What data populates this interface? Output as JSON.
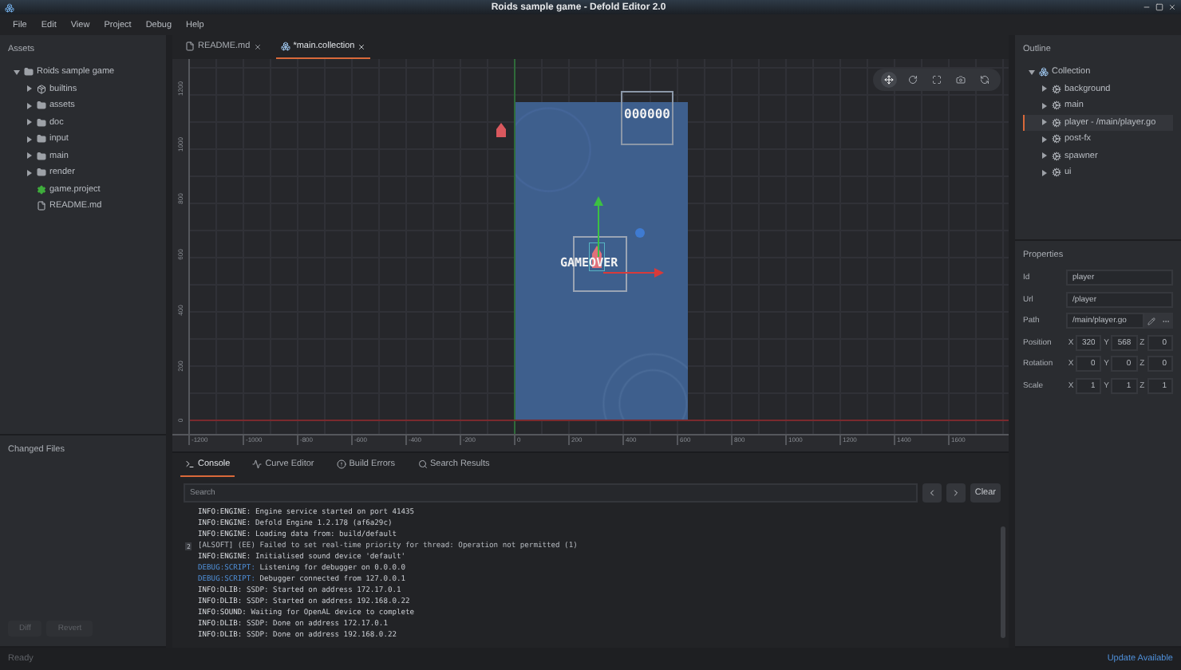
{
  "window": {
    "title": "Roids sample game - Defold Editor 2.0"
  },
  "menu": [
    "File",
    "Edit",
    "View",
    "Project",
    "Debug",
    "Help"
  ],
  "assets": {
    "title": "Assets",
    "tree": [
      {
        "label": "Roids sample game",
        "kind": "folder",
        "expanded": true,
        "children": [
          {
            "label": "builtins",
            "kind": "package",
            "expanded": false
          },
          {
            "label": "assets",
            "kind": "folder",
            "expanded": false
          },
          {
            "label": "doc",
            "kind": "folder",
            "expanded": false
          },
          {
            "label": "input",
            "kind": "folder",
            "expanded": false
          },
          {
            "label": "main",
            "kind": "folder",
            "expanded": false
          },
          {
            "label": "render",
            "kind": "folder",
            "expanded": false
          },
          {
            "label": "game.project",
            "kind": "project"
          },
          {
            "label": "README.md",
            "kind": "file"
          }
        ]
      }
    ]
  },
  "changed_files": {
    "title": "Changed Files",
    "buttons": [
      {
        "label": "Diff",
        "disabled": true
      },
      {
        "label": "Revert",
        "disabled": true
      }
    ]
  },
  "editor_tabs": [
    {
      "label": "README.md",
      "kind": "file",
      "selected": false
    },
    {
      "label": "*main.collection",
      "kind": "collection",
      "selected": true
    }
  ],
  "scene": {
    "tools": [
      {
        "kind": "move",
        "selected": true
      },
      {
        "kind": "rotate",
        "selected": false
      },
      {
        "kind": "scale",
        "selected": false
      },
      {
        "kind": "camera",
        "selected": false
      },
      {
        "kind": "reset",
        "selected": false
      }
    ],
    "score": "000000",
    "game_over": "GAMEOVER",
    "x_ruler": [
      "-1200",
      "-1000",
      "-800",
      "-600",
      "-400",
      "-200",
      "0",
      "200",
      "400",
      "600",
      "800",
      "1000",
      "1200",
      "1400",
      "1600"
    ],
    "y_ruler": [
      "1200",
      "1000",
      "800",
      "600",
      "400",
      "200",
      "0"
    ]
  },
  "bottom_tabs": [
    {
      "label": "Console",
      "kind": "console",
      "selected": true
    },
    {
      "label": "Curve Editor",
      "kind": "curve",
      "selected": false
    },
    {
      "label": "Build Errors",
      "kind": "errors",
      "selected": false
    },
    {
      "label": "Search Results",
      "kind": "search",
      "selected": false
    }
  ],
  "console": {
    "search": {
      "placeholder": "Search"
    },
    "clear": "Clear",
    "lines": [
      {
        "kind": "info",
        "tag": "INFO:ENGINE:",
        "message": "Engine service started on port 41435"
      },
      {
        "kind": "info",
        "tag": "INFO:ENGINE:",
        "message": "Defold Engine 1.2.178 (af6a29c)"
      },
      {
        "kind": "info",
        "tag": "INFO:ENGINE:",
        "message": "Loading data from: build/default"
      },
      {
        "kind": "plain",
        "count": "2",
        "message": "[ALSOFT] (EE) Failed to set real-time priority for thread: Operation not permitted (1)"
      },
      {
        "kind": "info",
        "tag": "INFO:ENGINE:",
        "message": "Initialised sound device 'default'"
      },
      {
        "kind": "debug",
        "tag": "DEBUG:SCRIPT:",
        "message": "Listening for debugger on 0.0.0.0"
      },
      {
        "kind": "debug",
        "tag": "DEBUG:SCRIPT:",
        "message": "Debugger connected from 127.0.0.1"
      },
      {
        "kind": "info",
        "tag": "INFO:DLIB:",
        "message": "SSDP: Started on address 172.17.0.1"
      },
      {
        "kind": "info",
        "tag": "INFO:DLIB:",
        "message": "SSDP: Started on address 192.168.0.22"
      },
      {
        "kind": "info",
        "tag": "INFO:SOUND:",
        "message": "Waiting for OpenAL device to complete"
      },
      {
        "kind": "info",
        "tag": "INFO:DLIB:",
        "message": "SSDP: Done on address 172.17.0.1"
      },
      {
        "kind": "info",
        "tag": "INFO:DLIB:",
        "message": "SSDP: Done on address 192.168.0.22"
      }
    ]
  },
  "outline": {
    "title": "Outline",
    "tree": [
      {
        "label": "Collection",
        "kind": "collection",
        "expanded": true,
        "selected": false,
        "children": [
          {
            "label": "background",
            "kind": "object",
            "expanded": false,
            "selected": false
          },
          {
            "label": "main",
            "kind": "object",
            "expanded": false,
            "selected": false
          },
          {
            "label": "player - /main/player.go",
            "kind": "object",
            "expanded": false,
            "selected": true
          },
          {
            "label": "post-fx",
            "kind": "object",
            "expanded": false,
            "selected": false
          },
          {
            "label": "spawner",
            "kind": "object",
            "expanded": false,
            "selected": false
          },
          {
            "label": "ui",
            "kind": "object",
            "expanded": false,
            "selected": false
          }
        ]
      }
    ]
  },
  "properties": {
    "title": "Properties",
    "fields": [
      {
        "label": "Id",
        "kind": "text",
        "value": "player"
      },
      {
        "label": "Url",
        "kind": "text",
        "value": "/player"
      },
      {
        "label": "Path",
        "kind": "path",
        "value": "/main/player.go"
      },
      {
        "label": "Position",
        "kind": "vector",
        "components": [
          {
            "axis": "X",
            "value": "320"
          },
          {
            "axis": "Y",
            "value": "568"
          },
          {
            "axis": "Z",
            "value": "0"
          }
        ]
      },
      {
        "label": "Rotation",
        "kind": "vector",
        "components": [
          {
            "axis": "X",
            "value": "0"
          },
          {
            "axis": "Y",
            "value": "0"
          },
          {
            "axis": "Z",
            "value": "0"
          }
        ]
      },
      {
        "label": "Scale",
        "kind": "vector",
        "components": [
          {
            "axis": "X",
            "value": "1"
          },
          {
            "axis": "Y",
            "value": "1"
          },
          {
            "axis": "Z",
            "value": "1"
          }
        ]
      }
    ]
  },
  "status_bar": {
    "left": "Ready",
    "right": "Update Available"
  }
}
